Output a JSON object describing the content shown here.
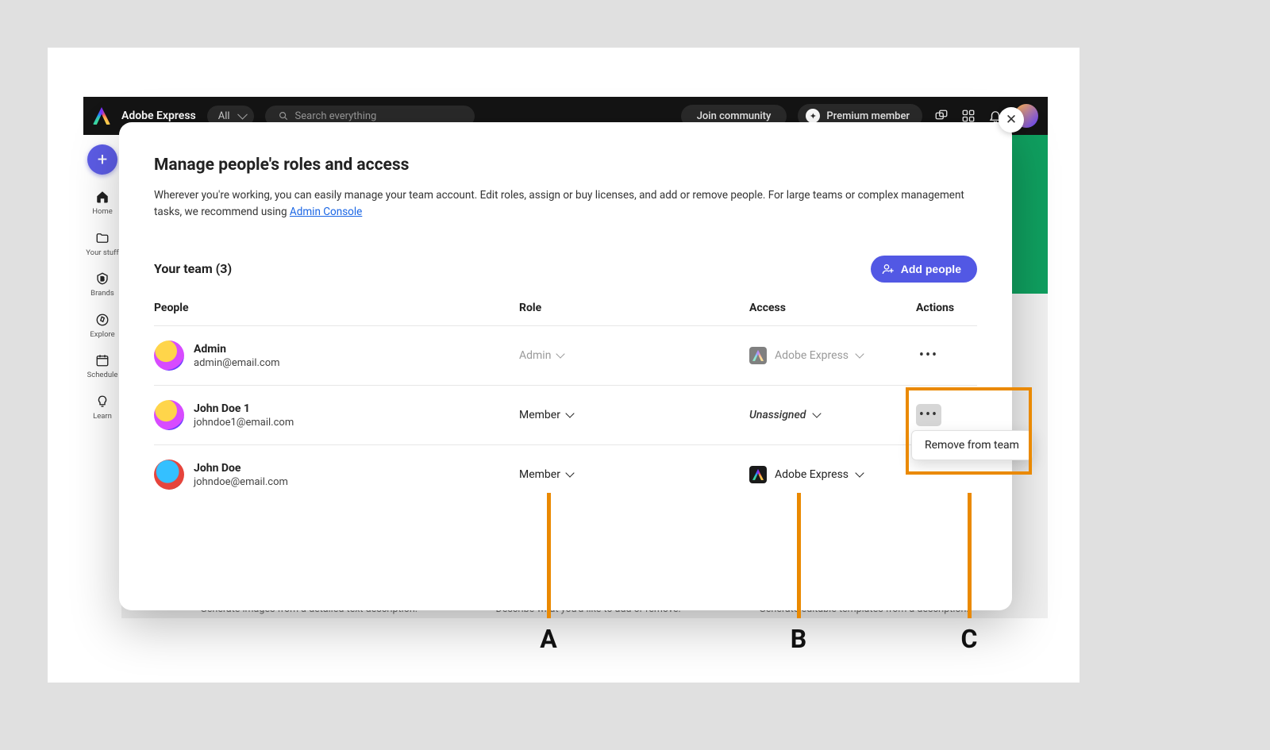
{
  "header": {
    "brand": "Adobe Express",
    "filter": "All",
    "search_placeholder": "Search everything",
    "join_community": "Join community",
    "premium": "Premium member"
  },
  "sidebar": {
    "items": [
      "Home",
      "Your stuff",
      "Brands",
      "Explore",
      "Schedule",
      "Learn"
    ]
  },
  "bg_captions": {
    "c1": "Generate images from a detailed text description.",
    "c2": "Describe what you'd like to add or remove.",
    "c3": "Generate editable templates from a description."
  },
  "modal": {
    "title": "Manage people's roles and access",
    "description_prefix": "Wherever you're working, you can easily manage your team account. Edit roles, assign or buy licenses, and add or remove people. For large teams or complex management tasks, we recommend using ",
    "admin_console_link": "Admin Console",
    "team_heading": "Your team (3)",
    "add_people": "Add people",
    "columns": {
      "people": "People",
      "role": "Role",
      "access": "Access",
      "actions": "Actions"
    },
    "rows": [
      {
        "name": "Admin",
        "email": "admin@email.com",
        "role": "Admin",
        "role_disabled": true,
        "access": "Adobe Express",
        "access_kind": "app-dim"
      },
      {
        "name": "John Doe 1",
        "email": "johndoe1@email.com",
        "role": "Member",
        "role_disabled": false,
        "access": "Unassigned",
        "access_kind": "italic"
      },
      {
        "name": "John Doe",
        "email": "johndoe@email.com",
        "role": "Member",
        "role_disabled": false,
        "access": "Adobe Express",
        "access_kind": "app"
      }
    ],
    "context_menu": "Remove from team"
  },
  "annotations": {
    "a": "A",
    "b": "B",
    "c": "C"
  }
}
